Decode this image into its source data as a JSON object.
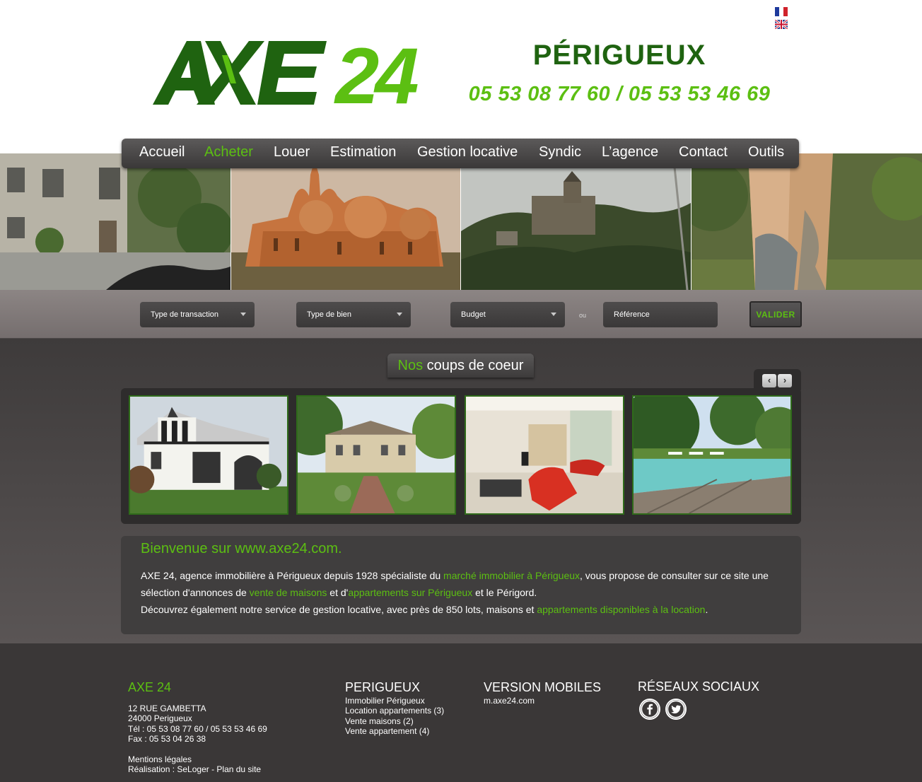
{
  "header": {
    "logo_text_axe": "AXE",
    "logo_text_24": "24",
    "city": "PÉRIGUEUX",
    "phones": "05 53 08 77 60 / 05 53 53 46 69"
  },
  "languages": [
    "FR",
    "EN"
  ],
  "nav": {
    "items": [
      "Accueil",
      "Acheter",
      "Louer",
      "Estimation",
      "Gestion locative",
      "Syndic",
      "L’agence",
      "Contact",
      "Outils"
    ],
    "active": "Acheter"
  },
  "search": {
    "transaction": "Type de transaction",
    "bien": "Type de bien",
    "budget": "Budget",
    "ou": "ou",
    "reference_placeholder": "Référence",
    "submit": "VALIDER"
  },
  "coeur": {
    "title_green": "Nos",
    "title_rest": " coups de coeur"
  },
  "welcome": {
    "title_a": "Bienvenue sur ",
    "title_b": "www.axe24.com.",
    "p1_a": "AXE 24, agence immobilière à Périgueux depuis 1928 spécialiste du ",
    "p1_link": "marché immobilier à Périgueux",
    "p1_b": ", vous propose de consulter sur ce site une sélection d'annonces de ",
    "p1_link2": "vente de maisons",
    "p1_c": " et d'",
    "p1_link3": "appartements sur Périgueux",
    "p1_d": " et le Périgord.",
    "p2_a": "Découvrez également notre service de gestion locative, avec près de 850 lots, maisons et ",
    "p2_link": "appartements disponibles à la location",
    "p2_b": "."
  },
  "footer": {
    "axe": {
      "title": "AXE 24",
      "address1": "12 RUE GAMBETTA",
      "address2": "24000 Perigueux",
      "tel": "Tél : 05 53 08 77 60 / 05 53 53 46 69",
      "fax": "Fax : 05 53 04 26 38",
      "mentions": "Mentions légales",
      "realisation": "Réalisation : SeLoger - Plan du site"
    },
    "perigueux": {
      "title": "PERIGUEUX",
      "links": [
        "Immobilier Périgueux",
        "Location appartements (3)",
        "Vente maisons (2)",
        "Vente appartement (4)"
      ]
    },
    "mobile": {
      "title": "VERSION MOBILES",
      "link": "m.axe24.com"
    },
    "social": {
      "title": "RÉSEAUX SOCIAUX",
      "icons": [
        "facebook-icon",
        "twitter-icon"
      ]
    }
  },
  "colors": {
    "brand_dark_green": "#1f6310",
    "brand_green": "#5cbf12",
    "dark_grey": "#3a3737"
  }
}
